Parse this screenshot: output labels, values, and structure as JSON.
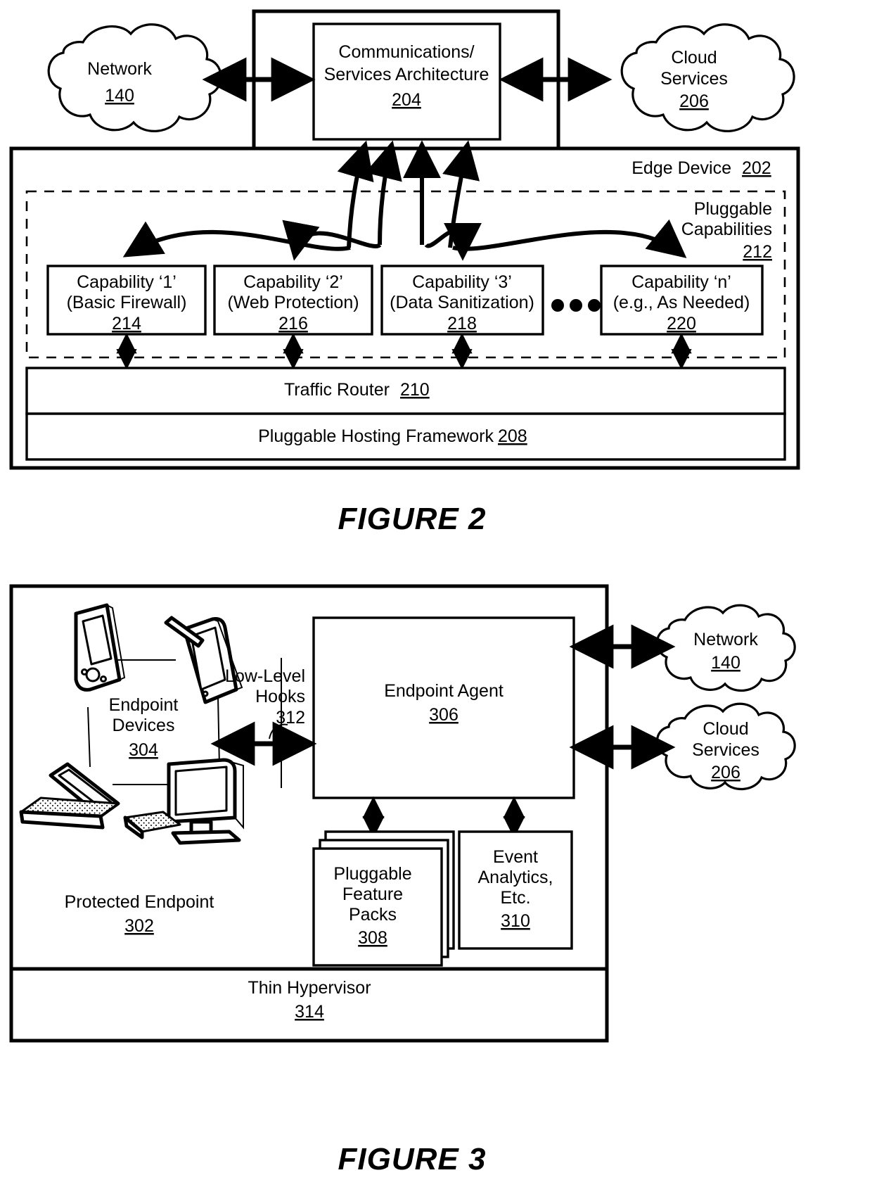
{
  "sheet": {
    "figures": [
      {
        "id": "figure-2",
        "caption": "FIGURE 2",
        "nodes": {
          "network_cloud": {
            "label": "Network",
            "ref": "140"
          },
          "comm_services": {
            "line1": "Communications/",
            "line2": "Services Architecture",
            "ref": "204"
          },
          "cloud_services": {
            "line1": "Cloud",
            "line2": "Services",
            "ref": "206"
          },
          "edge_device": {
            "label": "Edge Device",
            "ref": "202"
          },
          "pluggable_capabilities": {
            "line1": "Pluggable",
            "line2": "Capabilities",
            "ref": "212"
          },
          "traffic_router": {
            "label": "Traffic Router",
            "ref": "210"
          },
          "hosting_framework": {
            "label": "Pluggable Hosting Framework",
            "ref": "208"
          },
          "ellipsis": "• • •"
        },
        "capabilities": [
          {
            "title": "Capability ‘1’",
            "subtitle": "(Basic Firewall)",
            "ref": "214"
          },
          {
            "title": "Capability ‘2’",
            "subtitle": "(Web Protection)",
            "ref": "216"
          },
          {
            "title": "Capability ‘3’",
            "subtitle": "(Data Sanitization)",
            "ref": "218"
          },
          {
            "title": "Capability ‘n’",
            "subtitle": "(e.g., As Needed)",
            "ref": "220"
          }
        ]
      },
      {
        "id": "figure-3",
        "caption": "FIGURE 3",
        "nodes": {
          "protected_endpoint": {
            "label": "Protected Endpoint",
            "ref": "302"
          },
          "endpoint_devices": {
            "line1": "Endpoint",
            "line2": "Devices",
            "ref": "304"
          },
          "low_level_hooks": {
            "line1": "Low-Level",
            "line2": "Hooks",
            "ref": "312"
          },
          "endpoint_agent": {
            "label": "Endpoint Agent",
            "ref": "306"
          },
          "feature_packs": {
            "line1": "Pluggable",
            "line2": "Feature",
            "line3": "Packs",
            "ref": "308"
          },
          "event_analytics": {
            "line1": "Event",
            "line2": "Analytics,",
            "line3": "Etc.",
            "ref": "310"
          },
          "thin_hypervisor": {
            "label": "Thin Hypervisor",
            "ref": "314"
          },
          "network_cloud": {
            "label": "Network",
            "ref": "140"
          },
          "cloud_services": {
            "line1": "Cloud",
            "line2": "Services",
            "ref": "206"
          }
        }
      }
    ]
  },
  "colors": {
    "ink": "#000000",
    "paper": "#ffffff"
  }
}
